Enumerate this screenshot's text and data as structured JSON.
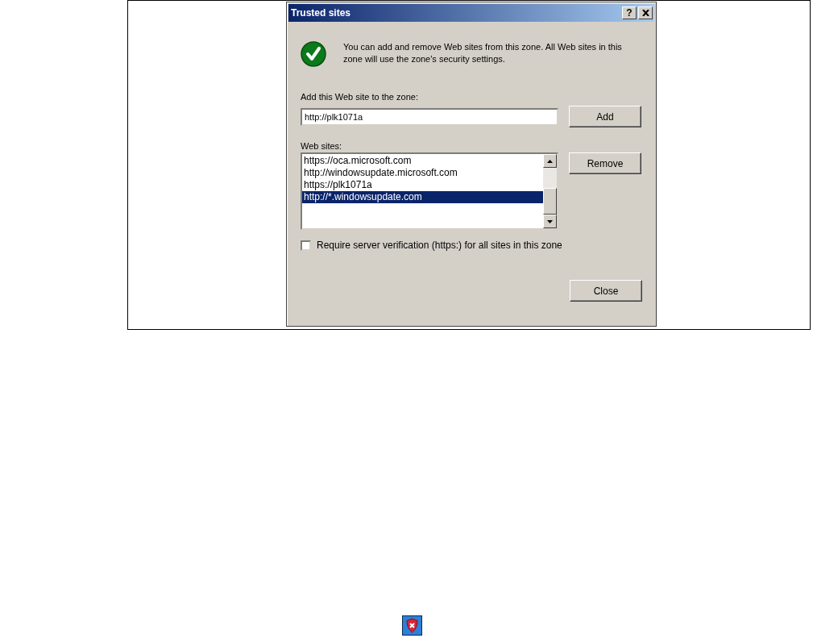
{
  "dialog": {
    "title": "Trusted sites",
    "help_button": "?",
    "message": "You can add and remove Web sites from this zone. All Web sites in this zone will use the zone's security settings.",
    "add_label": "Add this Web site to the zone:",
    "add_field": {
      "value": "http://plk1071a"
    },
    "add_button": "Add",
    "list_label": "Web sites:",
    "sites": [
      {
        "url": "https://oca.microsoft.com",
        "selected": false
      },
      {
        "url": "http://windowsupdate.microsoft.com",
        "selected": false
      },
      {
        "url": "https://plk1071a",
        "selected": false
      },
      {
        "url": "http://*.windowsupdate.com",
        "selected": true
      }
    ],
    "remove_button": "Remove",
    "require_https": {
      "label": "Require server verification (https:) for all sites in this zone",
      "checked": false
    },
    "close_button": "Close"
  }
}
